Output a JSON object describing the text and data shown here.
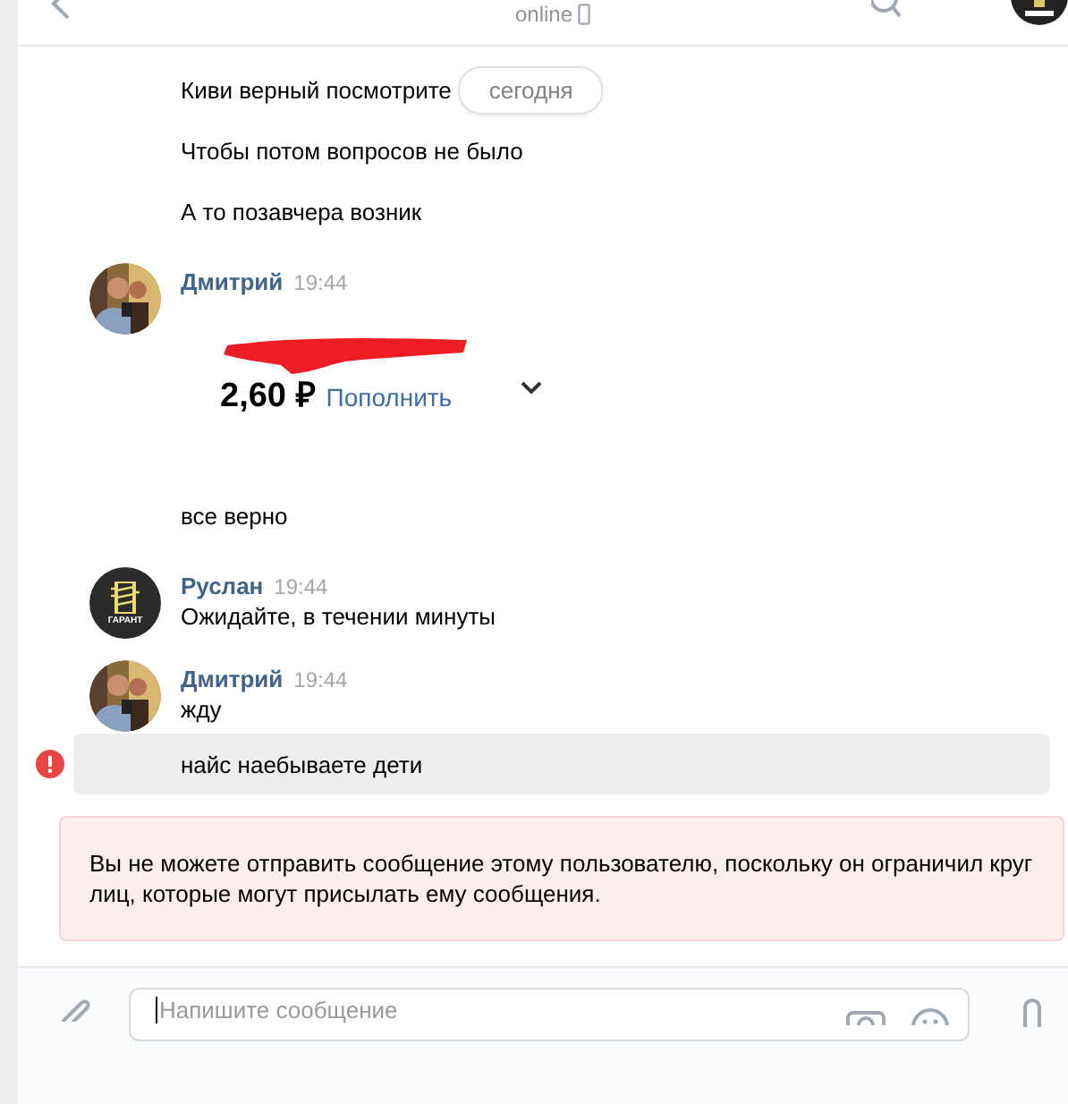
{
  "header": {
    "status": "online"
  },
  "date_badge": "сегодня",
  "messages": [
    {
      "kind": "text",
      "text": "Киви верный посмотрите",
      "date_badge": true
    },
    {
      "kind": "text",
      "text": "Чтобы потом вопросов не было"
    },
    {
      "kind": "text",
      "text": "А то позавчера возник"
    },
    {
      "kind": "author",
      "author": "Дмитрий",
      "time": "19:44"
    },
    {
      "balance": "2,60 ₽",
      "action": "Пополнить"
    },
    {
      "kind": "text",
      "text": "все верно"
    },
    {
      "kind": "author",
      "author": "Руслан",
      "time": "19:44",
      "avatar": {
        "kind": "logo",
        "text": "ГАРАНТ"
      },
      "text": "Ожидайте, в течении минуты"
    },
    {
      "kind": "author",
      "author": "Дмитрий",
      "time": "19:44",
      "text": "жду"
    },
    {
      "kind": "text",
      "text": "найс наебываете дети",
      "failed": true
    }
  ],
  "notice": "Вы не можете отправить сообщение этому пользователю, поскольку он ограничил круг лиц, которые могут присылать ему сообщения.",
  "composer": {
    "placeholder": "Напишите сообщение"
  }
}
